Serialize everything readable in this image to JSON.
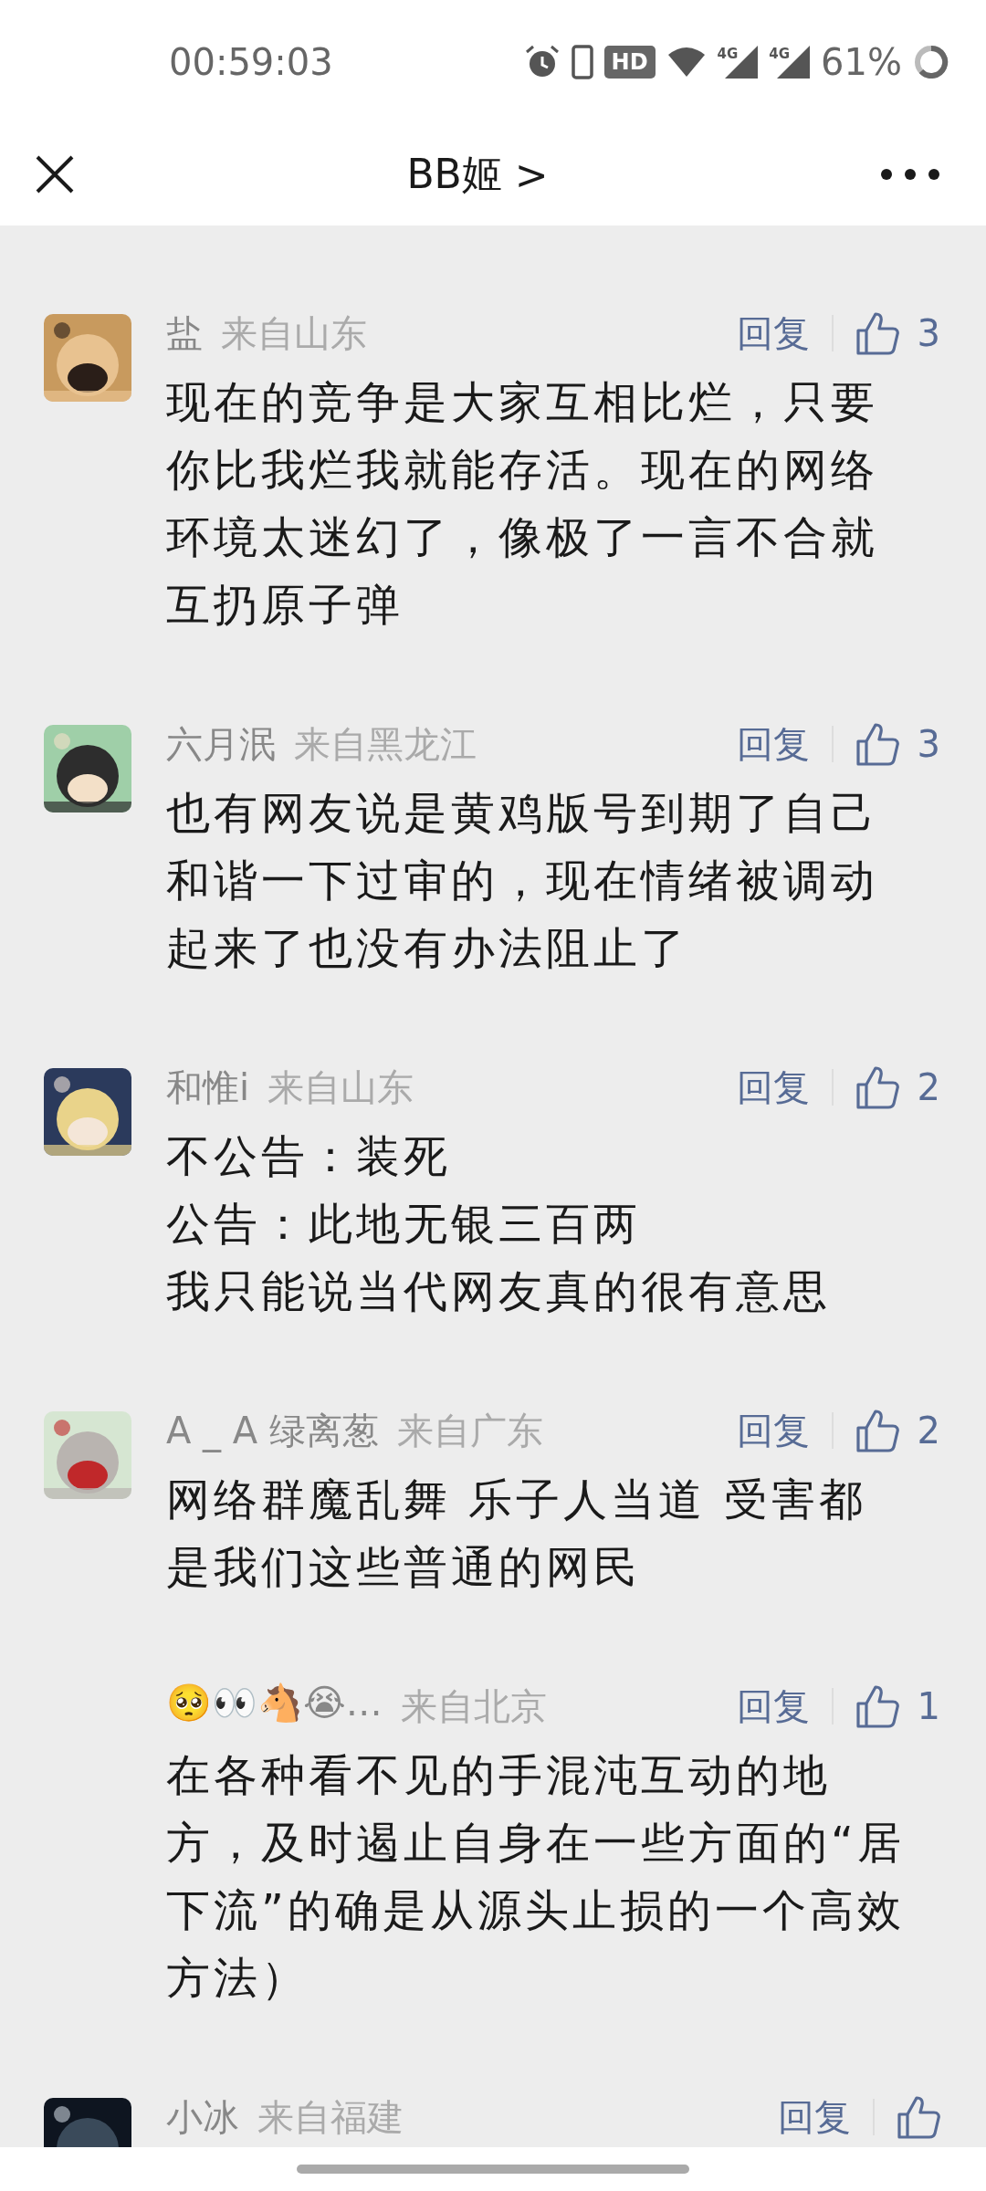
{
  "status_bar": {
    "time": "00:59:03",
    "network_badge": "HD",
    "sim_a": "4G",
    "sim_b": "4G",
    "battery": "61%"
  },
  "header": {
    "title": "BB姬",
    "chevron": ">"
  },
  "comments": [
    {
      "avatar": {
        "kind": "picture"
      },
      "name": "盐",
      "location": "来自山东",
      "reply": "回复",
      "likes": "3",
      "lines": [
        "现在的竞争是大家互相比烂，只要",
        "你比我烂我就能存活。现在的网络",
        "环境太迷幻了，像极了一言不合就",
        "互扔原子弹"
      ]
    },
    {
      "avatar": {
        "kind": "picture"
      },
      "name": "六月泯",
      "location": "来自黑龙江",
      "reply": "回复",
      "likes": "3",
      "lines": [
        "也有网友说是黄鸡版号到期了自己",
        "和谐一下过审的，现在情绪被调动",
        "起来了也没有办法阻止了"
      ]
    },
    {
      "avatar": {
        "kind": "picture"
      },
      "name": "和惟i",
      "location": "来自山东",
      "reply": "回复",
      "likes": "2",
      "lines": [
        "不公告：装死",
        "公告：此地无银三百两",
        "我只能说当代网友真的很有意思"
      ]
    },
    {
      "avatar": {
        "kind": "picture"
      },
      "name": "A _ A 绿离葱",
      "location": "来自广东",
      "reply": "回复",
      "likes": "2",
      "lines": [
        "网络群魔乱舞 乐子人当道 受害都",
        "是我们这些普通的网民"
      ]
    },
    {
      "name": "🥺👀🐴😭…",
      "location": "来自北京",
      "reply": "回复",
      "likes": "1",
      "lines": [
        "在各种看不见的手混沌互动的地",
        "方，及时遏止自身在一些方面的“居",
        "下流”的确是从源头止损的一个高效",
        "方法）"
      ]
    },
    {
      "avatar": {
        "kind": "picture"
      },
      "name": "小冰",
      "location": "来自福建",
      "reply": "回复"
    }
  ]
}
